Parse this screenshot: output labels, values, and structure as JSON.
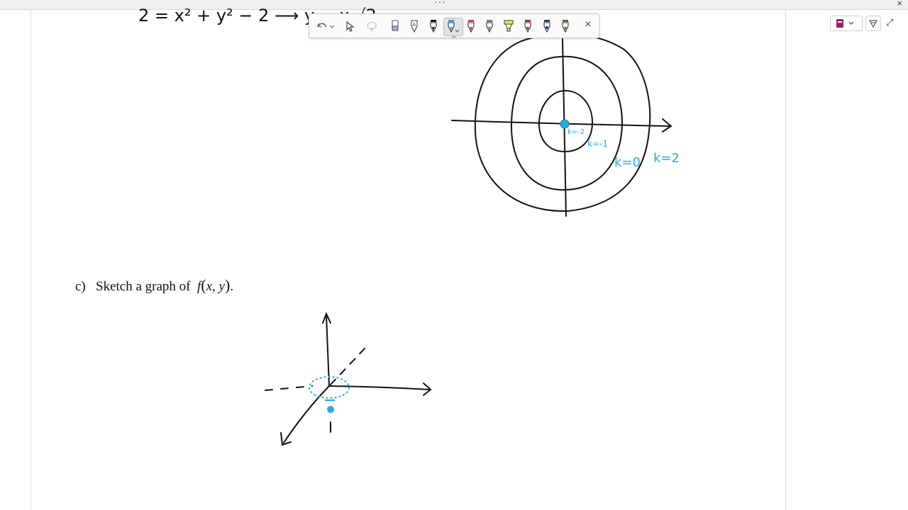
{
  "window": {
    "handle_dots": "···",
    "close_glyph": "×"
  },
  "document": {
    "top_equation_partial": "2 = x² + y² − 2 ⟶ y = x √2",
    "part_c": {
      "label": "c)",
      "text": "Sketch a graph of",
      "func_name": "f",
      "func_args": "x, y",
      "period": "."
    }
  },
  "contour_labels": [
    "k=-2",
    "k=-1",
    "k=0",
    "k=2"
  ],
  "toolbar": {
    "tools": [
      {
        "name": "undo-icon"
      },
      {
        "name": "select-arrow-icon"
      },
      {
        "name": "lasso-icon"
      },
      {
        "name": "eraser-icon",
        "color": "#c99bd3"
      },
      {
        "name": "pen-text-icon"
      },
      {
        "name": "pen-black-icon",
        "color": "#111111"
      },
      {
        "name": "pen-cyan-icon",
        "color": "#29abe2",
        "selected": true
      },
      {
        "name": "pen-red-icon",
        "color": "#e53935"
      },
      {
        "name": "pen-green-icon",
        "color": "#43a047"
      },
      {
        "name": "highlighter-yellow-icon",
        "color": "#ffeb3b"
      },
      {
        "name": "pen-magenta-icon",
        "color": "#c2185b"
      },
      {
        "name": "pen-navy-icon",
        "color": "#1a3d7a"
      },
      {
        "name": "pen-darkgreen-icon",
        "color": "#2e7d32"
      }
    ],
    "close_glyph": "×"
  },
  "colors": {
    "ink_black": "#111111",
    "ink_cyan": "#29abe2",
    "notebook": "#a01a64"
  }
}
